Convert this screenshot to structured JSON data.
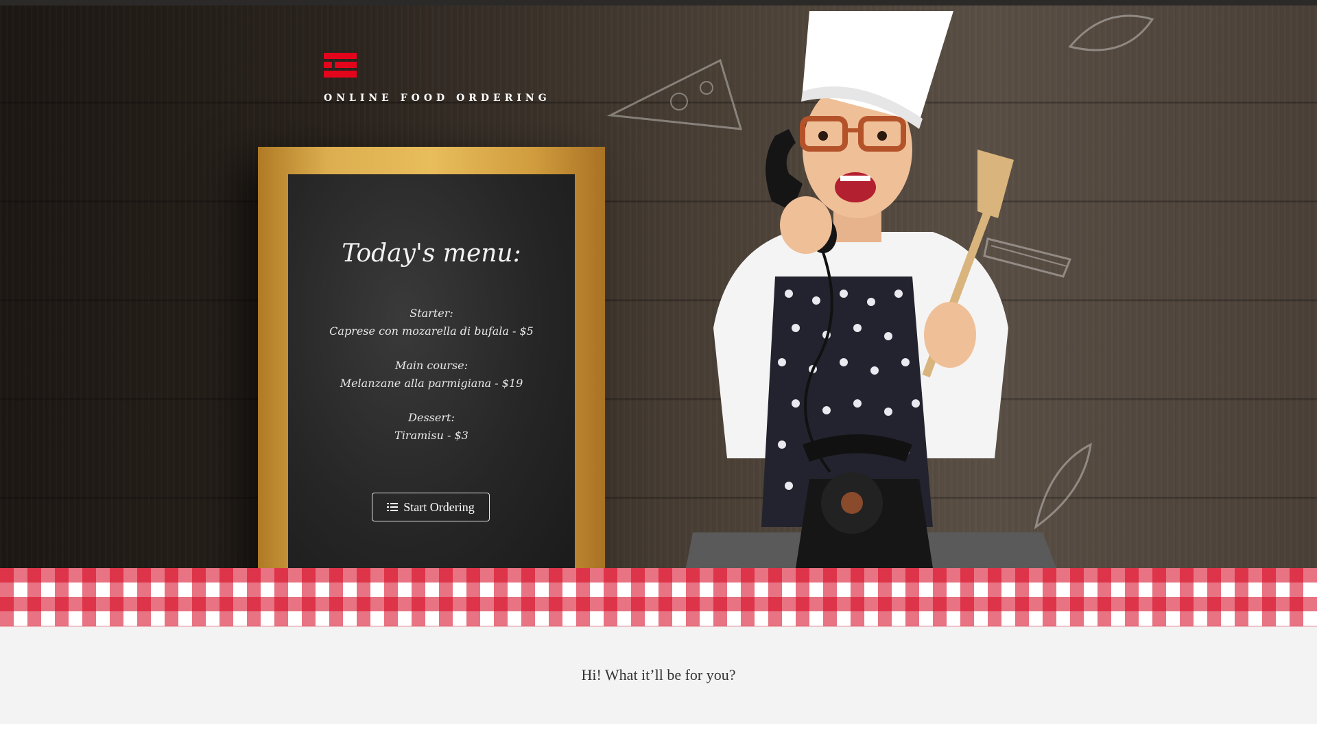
{
  "brand": {
    "name": "ONLINE FOOD ORDERING",
    "icon": "fork-knife-logo-icon",
    "accent_color": "#e3051b"
  },
  "menu_board": {
    "title": "Today's menu:",
    "courses": [
      {
        "course": "Starter:",
        "dish": "Caprese con mozarella di bufala - $5"
      },
      {
        "course": "Main course:",
        "dish": "Melanzane alla parmigiana - $19"
      },
      {
        "course": "Dessert:",
        "dish": "Tiramisu - $3"
      }
    ],
    "cta_label": "Start Ordering",
    "cta_icon": "list-icon"
  },
  "hero": {
    "image_subject": "chef-with-telephone-and-spatula"
  },
  "tablecloth": {
    "colors": [
      "#d5001c",
      "#ffffff"
    ]
  },
  "greeting": "Hi! What it’ll be for you?"
}
